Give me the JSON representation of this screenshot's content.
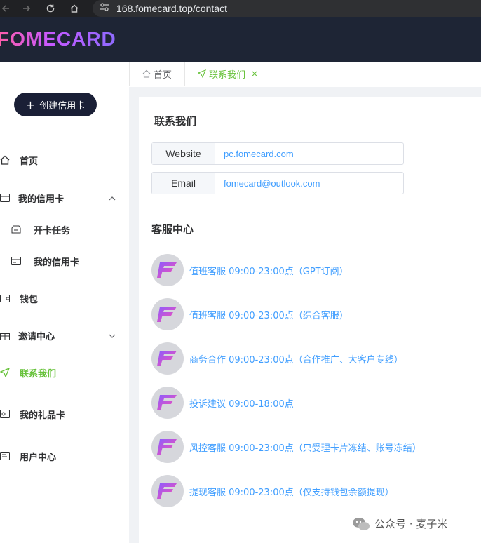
{
  "browser": {
    "url": "168.fomecard.top/contact"
  },
  "app": {
    "logo_text": "FOMECARD"
  },
  "sidebar": {
    "create_button": "创建信用卡",
    "items": [
      {
        "label": "首页"
      },
      {
        "label": "我的信用卡"
      },
      {
        "label": "开卡任务"
      },
      {
        "label": "我的信用卡"
      },
      {
        "label": "钱包"
      },
      {
        "label": "邀请中心"
      },
      {
        "label": "联系我们"
      },
      {
        "label": "我的礼品卡"
      },
      {
        "label": "用户中心"
      }
    ]
  },
  "tabs": [
    {
      "label": "首页"
    },
    {
      "label": "联系我们",
      "close": "×"
    }
  ],
  "contact": {
    "title": "联系我们",
    "rows": [
      {
        "label": "Website",
        "value": "pc.fomecard.com"
      },
      {
        "label": "Email",
        "value": "fomecard@outlook.com"
      }
    ]
  },
  "service": {
    "title": "客服中心",
    "items": [
      {
        "text": "值班客服 09:00-23:00点（GPT订阅）"
      },
      {
        "text": "值班客服 09:00-23:00点（综合客服）"
      },
      {
        "text": "商务合作 09:00-23:00点（合作推广、大客户专线）"
      },
      {
        "text": "投诉建议 09:00-18:00点"
      },
      {
        "text": "风控客服 09:00-23:00点（只受理卡片冻结、账号冻结）"
      },
      {
        "text": "提现客服 09:00-23:00点（仅支持钱包余额提现）"
      }
    ]
  },
  "watermark": {
    "text": "公众号 · 麦子米"
  },
  "colors": {
    "active_green": "#67c23a",
    "link_blue": "#409eff",
    "header_bg": "#1e2535"
  }
}
